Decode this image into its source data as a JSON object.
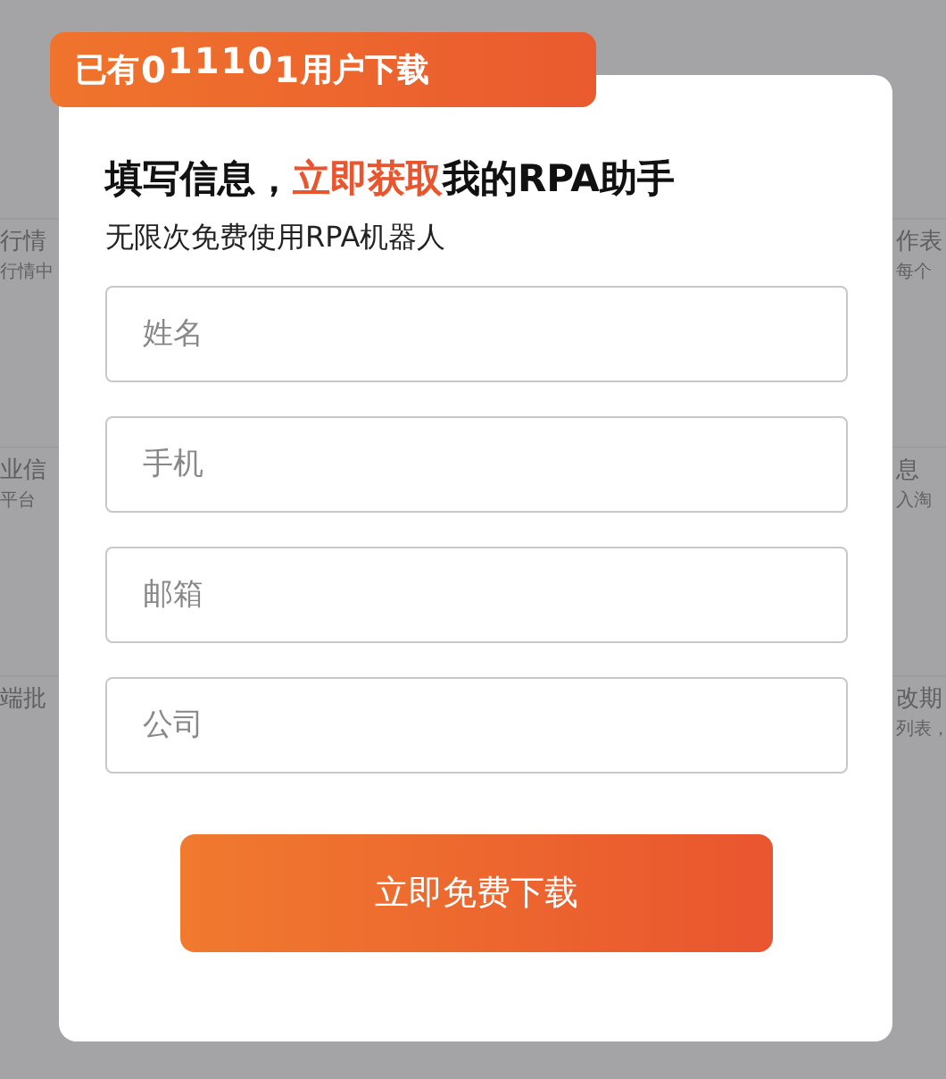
{
  "badge": {
    "prefix": "已有",
    "digits": [
      "0",
      "1",
      "1",
      "1",
      "0",
      "1"
    ],
    "suffix": "用户下载"
  },
  "heading": "填写信息，**立即获取**我的RPA助手",
  "subheading": "无限次免费使用RPA机器人",
  "fields": [
    {
      "placeholder": "姓名"
    },
    {
      "placeholder": "手机"
    },
    {
      "placeholder": "邮箱"
    },
    {
      "placeholder": "公司"
    }
  ],
  "submit": "立即免费下载",
  "background_left": [
    {
      "title": "行情",
      "line": "行情中"
    },
    {
      "title": "业信",
      "line": "平台"
    },
    {
      "title": "端批"
    }
  ],
  "background_right": [
    {
      "title": "作表",
      "line": "每个"
    },
    {
      "title": "息",
      "line": "入淘"
    },
    {
      "title": "改期",
      "line": "列表，"
    }
  ]
}
